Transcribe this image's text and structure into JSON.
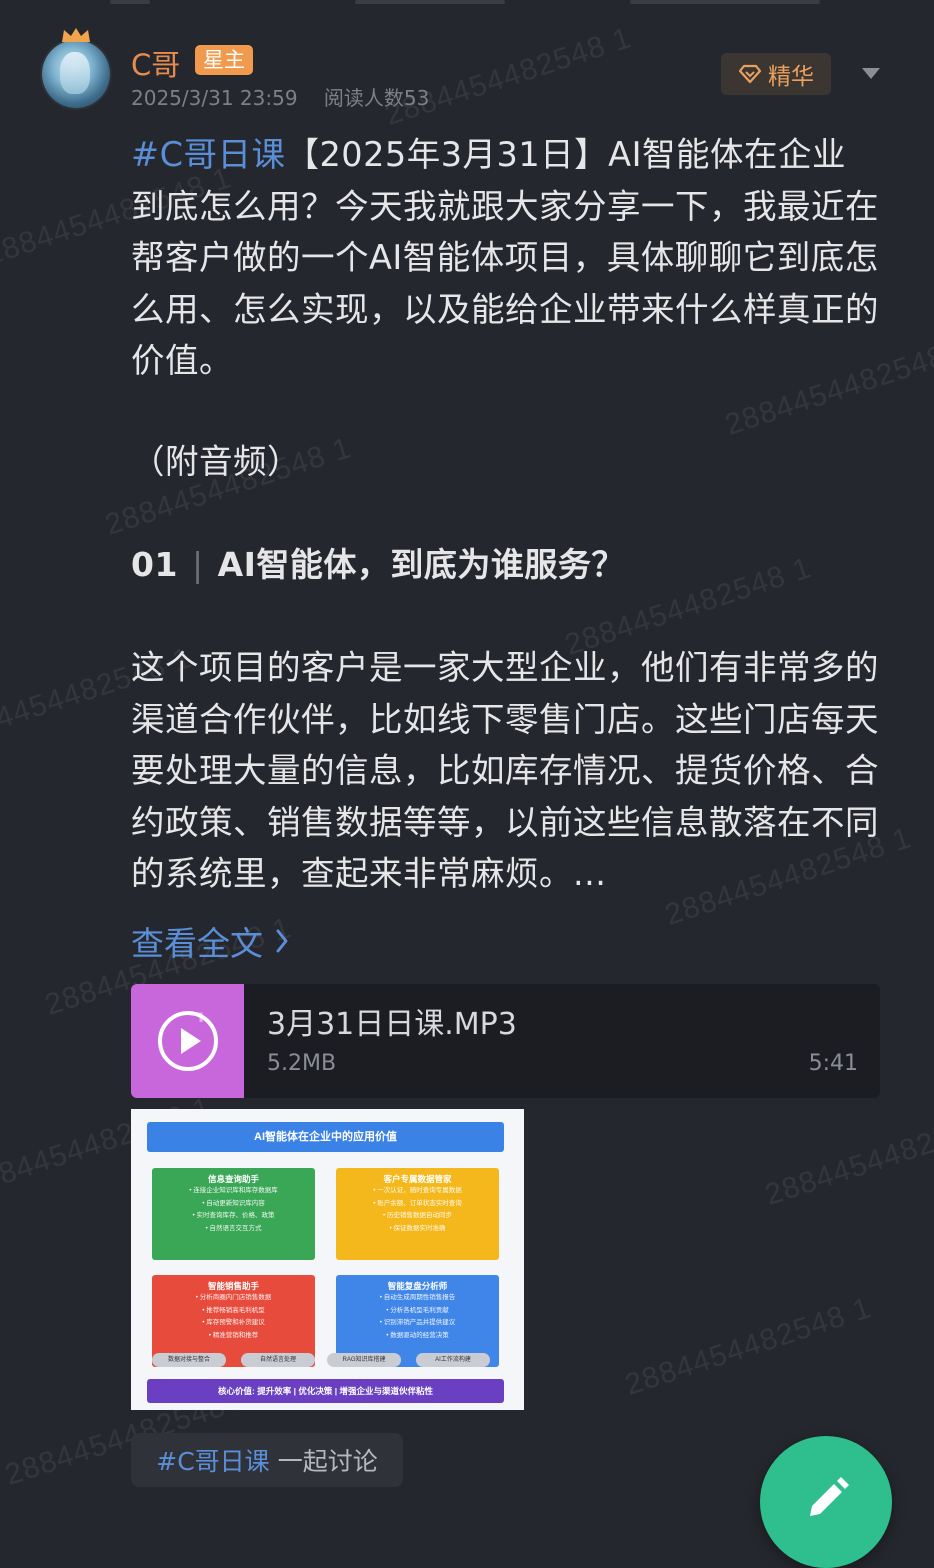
{
  "watermark": "2884454482548 1",
  "post": {
    "author": "C哥",
    "author_badge": "星主",
    "date": "2025/3/31 23:59",
    "reads": "阅读人数53",
    "essence_label": "精华",
    "tag": "#C哥日课",
    "p1_rest": "【2025年3月31日】AI智能体在企业到底怎么用？今天我就跟大家分享一下，我最近在帮客户做的一个AI智能体项目，具体聊聊它到底怎么用、怎么实现，以及能给企业带来什么样真正的价值。",
    "p2": "（附音频）",
    "heading_num": "01",
    "heading_text": "AI智能体，到底为谁服务？",
    "p3": "这个项目的客户是一家大型企业，他们有非常多的渠道合作伙伴，比如线下零售门店。这些门店每天要处理大量的信息，比如库存情况、提货价格、合约政策、销售数据等等，以前这些信息散落在不同的系统里，查起来非常麻烦。...",
    "read_more": "查看全文"
  },
  "audio": {
    "title": "3月31日日课.MP3",
    "size": "5.2MB",
    "duration": "5:41"
  },
  "infographic": {
    "title": "AI智能体在企业中的应用价值",
    "cards": [
      {
        "title": "信息查询助手",
        "color": "#3aa757",
        "lines": [
          "• 连接企业知识库和库存数据库",
          "• 自动更新知识库内容",
          "• 实时查询库存、价格、政策",
          "• 自然语言交互方式"
        ]
      },
      {
        "title": "客户专属数据管家",
        "color": "#f5b81c",
        "lines": [
          "• 一次认证，随时查询专属数据",
          "• 账户余额、订单状态实时查询",
          "• 历史销售数据自动同步",
          "• 保证数据实时准确"
        ]
      },
      {
        "title": "智能销售助手",
        "color": "#e64b3c",
        "lines": [
          "• 分析商圈内门店销售数据",
          "• 推荐畅销高毛利机型",
          "• 库存预警和补货建议",
          "• 精准营销和推荐"
        ]
      },
      {
        "title": "智能复盘分析师",
        "color": "#3f86e8",
        "lines": [
          "• 自动生成周期性销售报告",
          "• 分析各机型毛利贡献",
          "• 识别滞销产品并提供建议",
          "• 数据驱动的经营决策"
        ]
      }
    ],
    "pills": [
      "数据对接与整合",
      "自然语言处理",
      "RAG知识库搭建",
      "AI工作流构建"
    ],
    "footer": "核心价值: 提升效率 | 优化决策 | 增强企业与渠道伙伴粘性"
  },
  "discuss": {
    "tag": "#C哥日课",
    "label": "一起讨论"
  },
  "colors": {
    "background": "#25272e",
    "accent_blue": "#5a8fd8",
    "author_orange": "#e88c4e",
    "fab_green": "#2fbf8f"
  },
  "icons": [
    "crown-icon",
    "diamond-icon",
    "chevron-down-icon",
    "chevron-right-icon",
    "music-play-icon",
    "edit-pencil-icon"
  ]
}
